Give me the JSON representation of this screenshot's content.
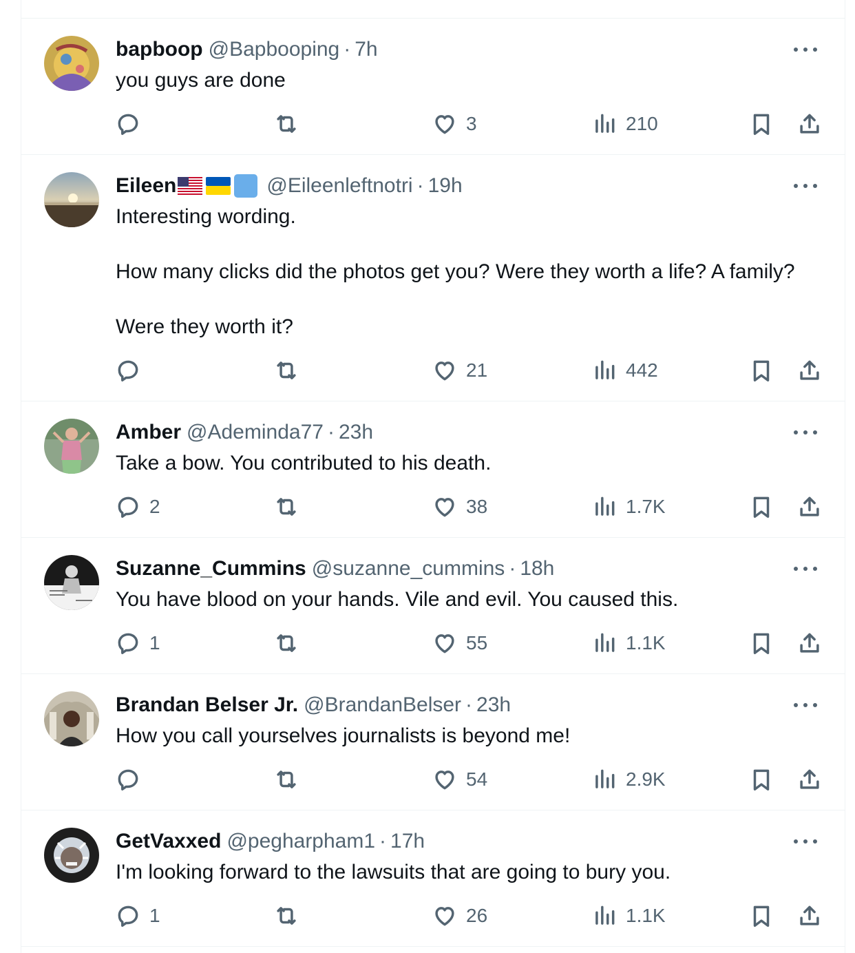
{
  "colors": {
    "text": "#0f1419",
    "secondary": "#536471",
    "divider": "#eff3f4"
  },
  "replies": [
    {
      "name": "bapboop",
      "handle": "@Bapbooping",
      "separator": "·",
      "time": "7h",
      "text": [
        "you guys are done"
      ],
      "reply_count": "",
      "like_count": "3",
      "view_count": "210",
      "avatar": "cartoon-avatar"
    },
    {
      "name": "Eileen",
      "name_badges": [
        "us-flag-icon",
        "ukraine-flag-icon",
        "blue-square-icon"
      ],
      "handle": "@Eileenleftnotri",
      "separator": "·",
      "time": "19h",
      "text": [
        "Interesting wording.",
        "How many clicks did the photos get you? Were they worth a life? A family?",
        "Were they worth it?"
      ],
      "reply_count": "",
      "like_count": "21",
      "view_count": "442",
      "avatar": "sunset-avatar"
    },
    {
      "name": "Amber",
      "handle": "@Ademinda77",
      "separator": "·",
      "time": "23h",
      "text": [
        "Take a bow. You contributed to his death."
      ],
      "reply_count": "2",
      "like_count": "38",
      "view_count": "1.7K",
      "avatar": "photo-avatar"
    },
    {
      "name": "Suzanne_Cummins",
      "handle": "@suzanne_cummins",
      "separator": "·",
      "time": "18h",
      "text": [
        "You have blood on your hands. Vile and evil. You caused this."
      ],
      "reply_count": "1",
      "like_count": "55",
      "view_count": "1.1K",
      "avatar": "bw-photo-avatar"
    },
    {
      "name": "Brandan Belser Jr.",
      "handle": "@BrandanBelser",
      "separator": "·",
      "time": "23h",
      "text": [
        "How you call yourselves journalists is beyond me!"
      ],
      "reply_count": "",
      "like_count": "54",
      "view_count": "2.9K",
      "avatar": "portrait-avatar"
    },
    {
      "name": "GetVaxxed",
      "handle": "@pegharpham1",
      "separator": "·",
      "time": "17h",
      "text": [
        "I'm looking forward to the lawsuits that are going to bury you."
      ],
      "reply_count": "1",
      "like_count": "26",
      "view_count": "1.1K",
      "avatar": "frost-avatar"
    }
  ]
}
